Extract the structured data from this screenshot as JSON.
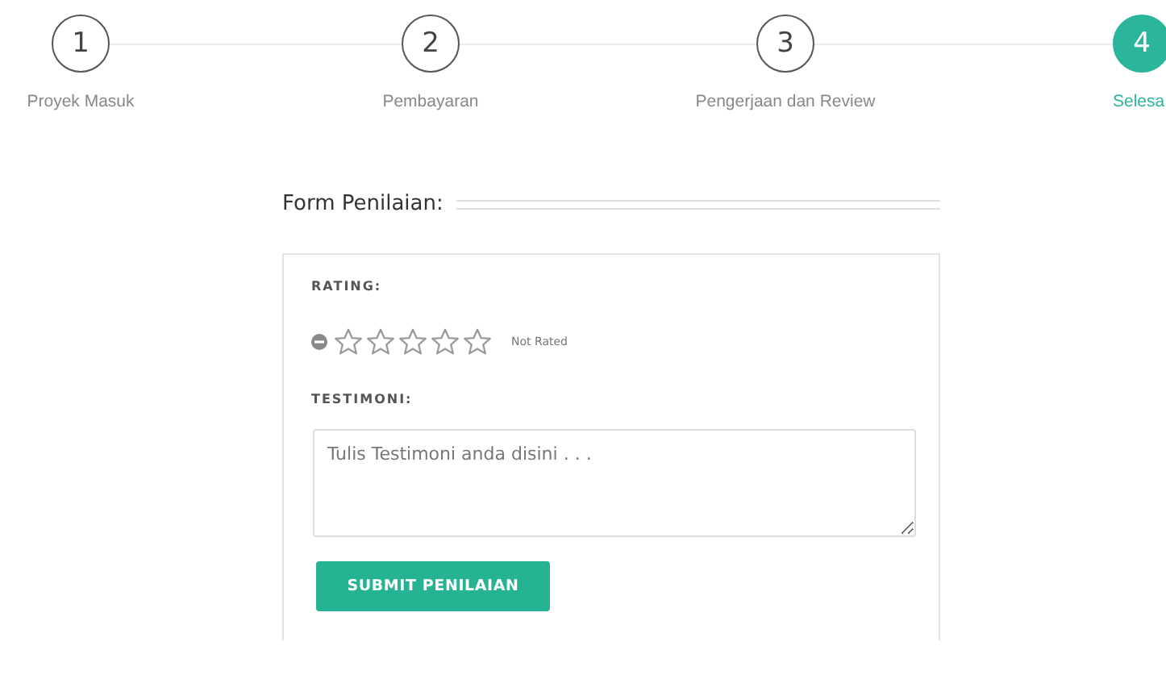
{
  "steps": [
    {
      "number": "1",
      "label": "Proyek Masuk",
      "selected": false
    },
    {
      "number": "2",
      "label": "Pembayaran",
      "selected": false
    },
    {
      "number": "3",
      "label": "Pengerjaan dan Review",
      "selected": false
    },
    {
      "number": "4",
      "label": "Selesa",
      "selected": true
    }
  ],
  "form": {
    "title": "Form Penilaian:",
    "rating": {
      "label": "RATING:",
      "stars": 0,
      "status": "Not Rated"
    },
    "testimoni": {
      "label": "TESTIMONI:",
      "placeholder": "Tulis Testimoni anda disini . . ."
    },
    "submit_button": "SUBMIT PENILAIAN"
  }
}
